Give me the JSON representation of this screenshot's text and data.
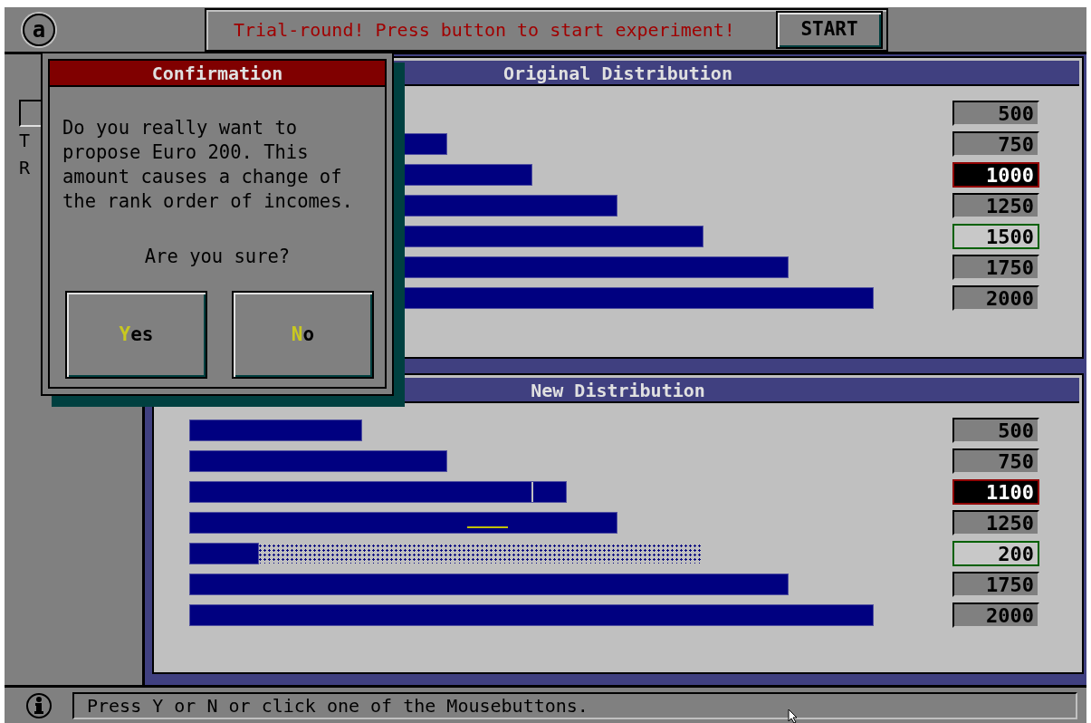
{
  "top_bar": {
    "logo_letter": "a",
    "message": "Trial-round! Press button to start experiment!",
    "start_button": "START"
  },
  "left_panel": {
    "checkbox_checked": false,
    "labels": [
      "T",
      "R"
    ]
  },
  "original": {
    "title": "Original Distribution",
    "rows": [
      {
        "value": "500",
        "marked": false,
        "own": false
      },
      {
        "value": "750",
        "marked": false,
        "own": false
      },
      {
        "value": "1000",
        "marked": true,
        "own": false
      },
      {
        "value": "1250",
        "marked": false,
        "own": false
      },
      {
        "value": "1500",
        "marked": false,
        "own": true
      },
      {
        "value": "1750",
        "marked": false,
        "own": false
      },
      {
        "value": "2000",
        "marked": false,
        "own": false
      }
    ]
  },
  "new": {
    "title": "New Distribution",
    "rows": [
      {
        "value": "500",
        "marked": false,
        "own": false
      },
      {
        "value": "750",
        "marked": false,
        "own": false
      },
      {
        "value": "1100",
        "marked": true,
        "own": false
      },
      {
        "value": "1250",
        "marked": false,
        "own": false,
        "marker": true
      },
      {
        "value": "200",
        "marked": false,
        "own": true
      },
      {
        "value": "1750",
        "marked": false,
        "own": false
      },
      {
        "value": "2000",
        "marked": false,
        "own": false
      }
    ]
  },
  "dialog": {
    "title": "Confirmation",
    "message": "Do you really want to\npropose Euro 200. This\namount causes a change of\nthe rank order of incomes.",
    "question": "Are you sure?",
    "buttons": [
      {
        "hotkey": "Y",
        "rest": "es"
      },
      {
        "hotkey": "N",
        "rest": "o"
      }
    ]
  },
  "status_bar": {
    "text": "Press Y or N or click one of the Mousebuttons."
  }
}
